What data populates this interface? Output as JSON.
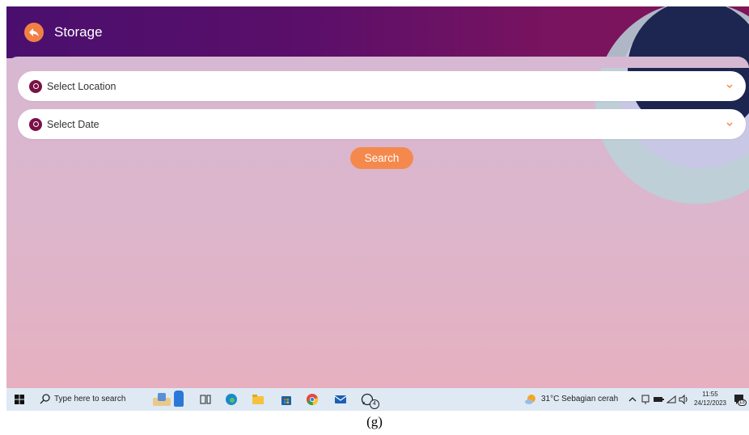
{
  "app": {
    "title": "Storage",
    "location_select": {
      "label": "Select Location"
    },
    "date_select": {
      "label": "Select Date"
    },
    "search_label": "Search"
  },
  "taskbar": {
    "search_placeholder": "Type here to search",
    "weather": "31°C  Sebagian cerah",
    "time": "11:55",
    "date": "24/12/2023",
    "whatsapp_badge": "4",
    "notification_count": "13"
  },
  "caption": "(g)",
  "colors": {
    "header_start": "#4a0f6e",
    "header_end": "#7d1558",
    "accent": "#f5894d",
    "pin": "#7a1146"
  },
  "icons": [
    "back-arrow-icon",
    "location-pin-icon",
    "chevron-down-icon",
    "windows-start-icon",
    "search-icon",
    "task-view-icon",
    "edge-icon",
    "file-explorer-icon",
    "store-icon",
    "chrome-icon",
    "mail-icon",
    "whatsapp-icon",
    "weather-icon",
    "chevron-up-icon",
    "network-icon",
    "volume-icon",
    "notifications-icon"
  ]
}
